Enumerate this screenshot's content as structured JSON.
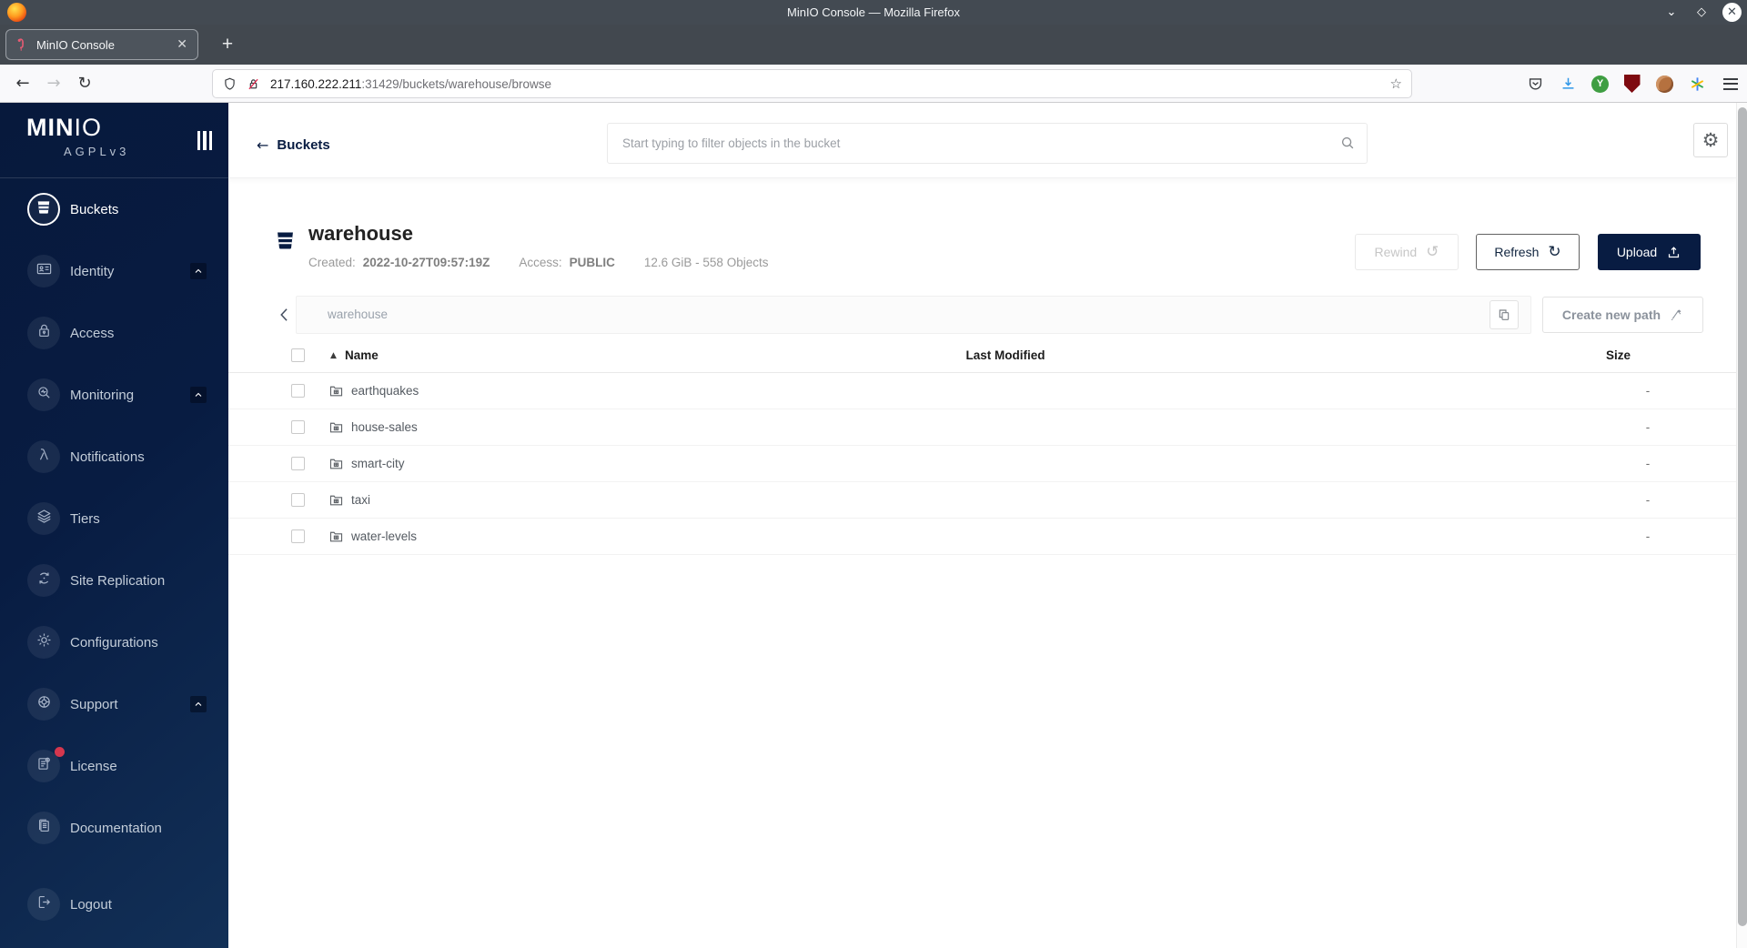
{
  "window": {
    "title": "MinIO Console — Mozilla Firefox"
  },
  "browser": {
    "tab_title": "MinIO Console",
    "new_tab_label": "+",
    "url_host": "217.160.222.211",
    "url_path": ":31429/buckets/warehouse/browse"
  },
  "sidebar": {
    "logo_bold": "MIN",
    "logo_light": "IO",
    "license_tag": "AGPLv3",
    "items": [
      {
        "label": "Buckets",
        "icon": "bucket",
        "active": true
      },
      {
        "label": "Identity",
        "icon": "identity",
        "expandable": true
      },
      {
        "label": "Access",
        "icon": "access"
      },
      {
        "label": "Monitoring",
        "icon": "monitoring",
        "expandable": true
      },
      {
        "label": "Notifications",
        "icon": "lambda"
      },
      {
        "label": "Tiers",
        "icon": "tiers"
      },
      {
        "label": "Site Replication",
        "icon": "replication"
      },
      {
        "label": "Configurations",
        "icon": "gear"
      },
      {
        "label": "Support",
        "icon": "support",
        "expandable": true
      },
      {
        "label": "License",
        "icon": "license",
        "badge": true
      },
      {
        "label": "Documentation",
        "icon": "documentation"
      },
      {
        "label": "Logout",
        "icon": "logout",
        "spaced": true
      }
    ]
  },
  "header": {
    "back_label": "Buckets",
    "search_placeholder": "Start typing to filter objects in the bucket"
  },
  "bucket": {
    "name": "warehouse",
    "created_label": "Created:",
    "created_value": "2022-10-27T09:57:19Z",
    "access_label": "Access:",
    "access_value": "PUBLIC",
    "usage": "12.6 GiB - 558 Objects",
    "rewind_label": "Rewind",
    "refresh_label": "Refresh",
    "upload_label": "Upload"
  },
  "pathbar": {
    "current_path": "warehouse",
    "create_path_label": "Create new path"
  },
  "table": {
    "columns": {
      "name": "Name",
      "last_modified": "Last Modified",
      "size": "Size"
    },
    "rows": [
      {
        "name": "earthquakes",
        "size": "-"
      },
      {
        "name": "house-sales",
        "size": "-"
      },
      {
        "name": "smart-city",
        "size": "-"
      },
      {
        "name": "taxi",
        "size": "-"
      },
      {
        "name": "water-levels",
        "size": "-"
      }
    ]
  },
  "colors": {
    "brand_navy": "#081C42",
    "badge_red": "#d5374e",
    "download_blue": "#2f97e8"
  }
}
